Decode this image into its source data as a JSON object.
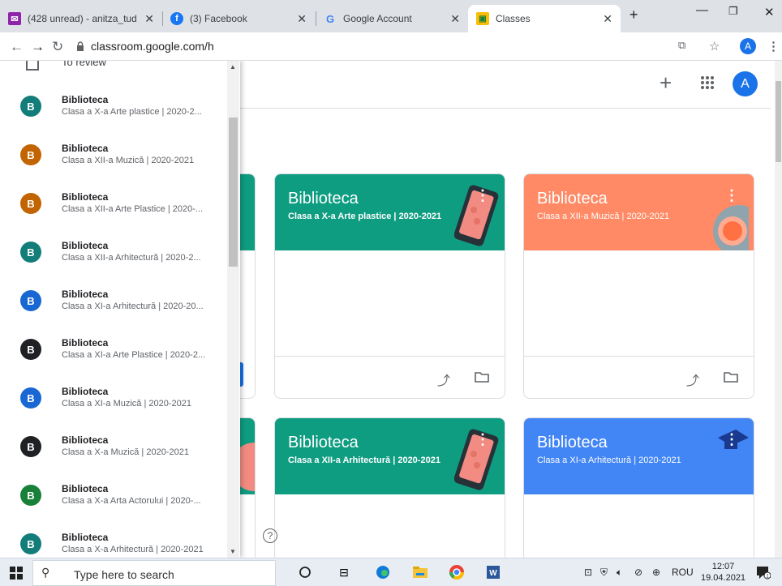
{
  "browser": {
    "tabs": [
      {
        "title": "(428 unread) - anitza_tud",
        "icon": "gmail-icon",
        "color": "#8e24aa"
      },
      {
        "title": "(3) Facebook",
        "icon": "facebook-icon",
        "color": "#1877f2"
      },
      {
        "title": "Google Account",
        "icon": "google-icon",
        "color": "#4285f4"
      },
      {
        "title": "Classes",
        "icon": "classroom-icon",
        "color": "#fbbc04"
      }
    ],
    "new_tab": "+",
    "url": "classroom.google.com/h",
    "account_initial": "A"
  },
  "header": {
    "add": "+",
    "account_initial": "A"
  },
  "sidebar": {
    "review_label": "To review",
    "items": [
      {
        "initial": "B",
        "name": "Biblioteca",
        "sub": "Clasa a X-a Arte plastice | 2020-2...",
        "color": "#137d79"
      },
      {
        "initial": "B",
        "name": "Biblioteca",
        "sub": "Clasa a XII-a Muzică | 2020-2021",
        "color": "#c26401"
      },
      {
        "initial": "B",
        "name": "Biblioteca",
        "sub": "Clasa a XII-a Arte Plastice | 2020-...",
        "color": "#c26401"
      },
      {
        "initial": "B",
        "name": "Biblioteca",
        "sub": "Clasa a XII-a Arhitectură | 2020-2...",
        "color": "#137d79"
      },
      {
        "initial": "B",
        "name": "Biblioteca",
        "sub": "Clasa a XI-a Arhitectură | 2020-20...",
        "color": "#1967d2"
      },
      {
        "initial": "B",
        "name": "Biblioteca",
        "sub": "Clasa a XI-a Arte Plastice | 2020-2...",
        "color": "#202124"
      },
      {
        "initial": "B",
        "name": "Biblioteca",
        "sub": "Clasa a XI-a Muzică | 2020-2021",
        "color": "#1967d2"
      },
      {
        "initial": "B",
        "name": "Biblioteca",
        "sub": "Clasa a X-a Muzică | 2020-2021",
        "color": "#202124"
      },
      {
        "initial": "B",
        "name": "Biblioteca",
        "sub": "Clasa a X-a Arta Actorului | 2020-...",
        "color": "#188038"
      },
      {
        "initial": "B",
        "name": "Biblioteca",
        "sub": "Clasa a X-a Arhitectură | 2020-2021",
        "color": "#137d79"
      }
    ]
  },
  "cards": [
    {
      "title": "Biblioteca",
      "sub": "Clasa a X-a Arte plastice | 2020-2021",
      "color": "#0f9d82"
    },
    {
      "title": "Biblioteca",
      "sub": "Clasa a XII-a Muzică | 2020-2021",
      "color": "#ff8a65"
    },
    {
      "title": "Biblioteca",
      "sub": "Clasa a XII-a Arhitectură | 2020-2021",
      "color": "#0f9d82"
    },
    {
      "title": "Biblioteca",
      "sub": "Clasa a XI-a Arhitectură | 2020-2021",
      "color": "#4285f4"
    }
  ],
  "help": "?",
  "taskbar": {
    "search_placeholder": "Type here to search",
    "lang": "ROU",
    "time": "12:07",
    "date": "19.04.2021",
    "notif_count": "1"
  }
}
